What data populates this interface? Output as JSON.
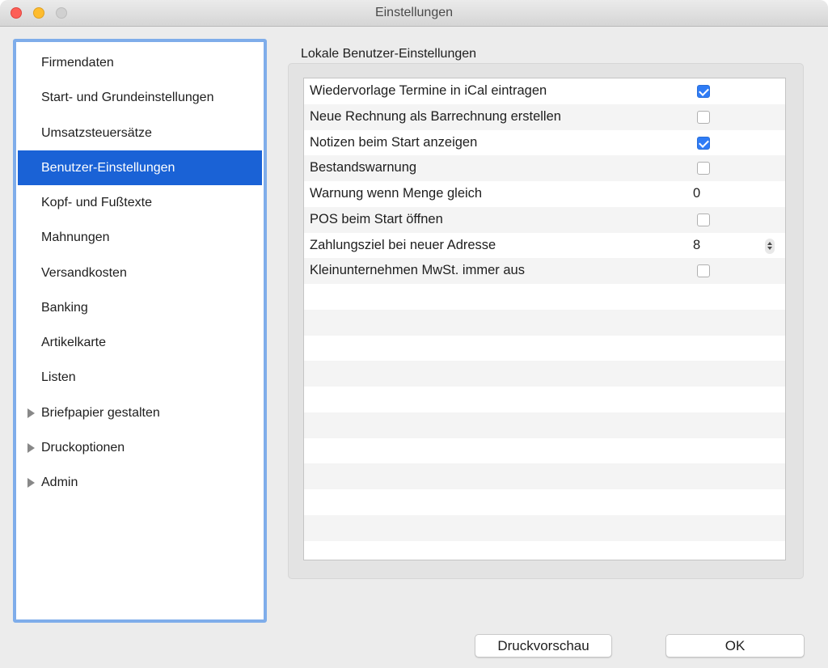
{
  "window": {
    "title": "Einstellungen",
    "controls": [
      "close",
      "minimize",
      "zoom"
    ]
  },
  "sidebar": {
    "selected_index": 3,
    "items": [
      {
        "label": "Firmendaten",
        "expandable": false
      },
      {
        "label": "Start- und Grundeinstellungen",
        "expandable": false
      },
      {
        "label": "Umsatzsteuersätze",
        "expandable": false
      },
      {
        "label": "Benutzer-Einstellungen",
        "expandable": false
      },
      {
        "label": "Kopf- und Fußtexte",
        "expandable": false
      },
      {
        "label": "Mahnungen",
        "expandable": false
      },
      {
        "label": "Versandkosten",
        "expandable": false
      },
      {
        "label": "Banking",
        "expandable": false
      },
      {
        "label": "Artikelkarte",
        "expandable": false
      },
      {
        "label": "Listen",
        "expandable": false
      },
      {
        "label": "Briefpapier gestalten",
        "expandable": true
      },
      {
        "label": "Druckoptionen",
        "expandable": true
      },
      {
        "label": "Admin",
        "expandable": true
      }
    ]
  },
  "settings": {
    "section_title": "Lokale Benutzer-Einstellungen",
    "rows": [
      {
        "label": "Wiedervorlage Termine in iCal eintragen",
        "type": "checkbox",
        "checked": true
      },
      {
        "label": "Neue Rechnung als Barrechnung erstellen",
        "type": "checkbox",
        "checked": false
      },
      {
        "label": "Notizen beim Start anzeigen",
        "type": "checkbox",
        "checked": true
      },
      {
        "label": "Bestandswarnung",
        "type": "checkbox",
        "checked": false
      },
      {
        "label": "Warnung wenn Menge gleich",
        "type": "number",
        "value": "0"
      },
      {
        "label": "POS beim Start öffnen",
        "type": "checkbox",
        "checked": false
      },
      {
        "label": "Zahlungsziel bei neuer Adresse",
        "type": "stepper",
        "value": "8"
      },
      {
        "label": "Kleinunternehmen MwSt. immer aus",
        "type": "checkbox",
        "checked": false
      }
    ],
    "empty_rows": 11
  },
  "footer": {
    "preview_label": "Druckvorschau",
    "ok_label": "OK"
  },
  "colors": {
    "accent": "#1a62d6",
    "checkbox_on": "#2f7cf6",
    "sidebar_focus_ring": "#7fadea"
  }
}
